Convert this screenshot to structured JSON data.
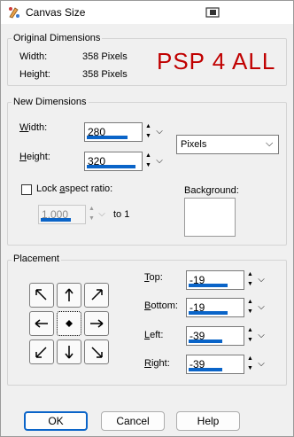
{
  "window": {
    "title": "Canvas Size"
  },
  "original": {
    "legend": "Original Dimensions",
    "width_label": "Width:",
    "width_value": "358 Pixels",
    "height_label": "Height:",
    "height_value": "358 Pixels",
    "watermark": "PSP 4 ALL"
  },
  "new_dim": {
    "legend": "New Dimensions",
    "width_label": "Width:",
    "width_value": "280",
    "height_label": "Height:",
    "height_value": "320",
    "units_selected": "Pixels",
    "lock_label": "Lock aspect ratio:",
    "ratio_value": "1.000",
    "to_label": "to 1",
    "background_label": "Background:"
  },
  "placement": {
    "legend": "Placement",
    "top_label": "Top:",
    "top_value": "-19",
    "bottom_label": "Bottom:",
    "bottom_value": "-19",
    "left_label": "Left:",
    "left_value": "-39",
    "right_label": "Right:",
    "right_value": "-39"
  },
  "buttons": {
    "ok": "OK",
    "cancel": "Cancel",
    "help": "Help"
  },
  "colors": {
    "accent": "#0a64c8",
    "watermark": "#c00000"
  },
  "icons": [
    "app-palette-icon",
    "window-restore-icon"
  ]
}
